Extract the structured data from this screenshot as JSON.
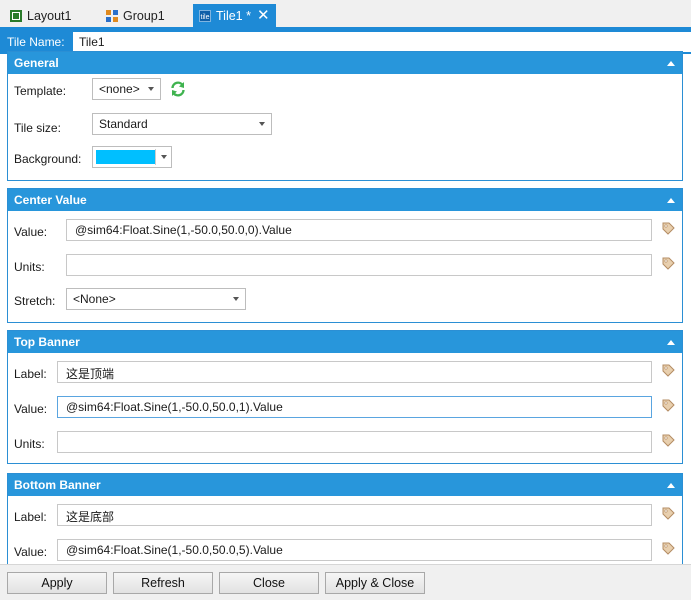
{
  "tabs": [
    {
      "label": "Layout1",
      "icon": "layout-icon"
    },
    {
      "label": "Group1",
      "icon": "group-icon"
    },
    {
      "label": "Tile1 *",
      "icon": "tile-icon",
      "icon_text": "tile",
      "active": true
    }
  ],
  "tile_name": {
    "label": "Tile  Name:",
    "value": "Tile1"
  },
  "general": {
    "title": "General",
    "template_label": "Template:",
    "template_value": "<none>",
    "tile_size_label": "Tile size:",
    "tile_size_value": "Standard",
    "background_label": "Background:",
    "background_color": "#00bfff"
  },
  "center_value": {
    "title": "Center Value",
    "value_label": "Value:",
    "value": "@sim64:Float.Sine(1,-50.0,50.0,0).Value",
    "units_label": "Units:",
    "units": "",
    "stretch_label": "Stretch:",
    "stretch": "<None>"
  },
  "top_banner": {
    "title": "Top Banner",
    "label_label": "Label:",
    "label": "这是顶端",
    "value_label": "Value:",
    "value": "@sim64:Float.Sine(1,-50.0,50.0,1).Value",
    "units_label": "Units:",
    "units": ""
  },
  "bottom_banner": {
    "title": "Bottom Banner",
    "label_label": "Label:",
    "label": "这是底部",
    "value_label": "Value:",
    "value": "@sim64:Float.Sine(1,-50.0,50.0,5).Value"
  },
  "buttons": {
    "apply": "Apply",
    "refresh": "Refresh",
    "close": "Close",
    "apply_close": "Apply & Close"
  },
  "colors": {
    "accent": "#1e8ad6",
    "refresh_icon": "#3fb34f"
  }
}
